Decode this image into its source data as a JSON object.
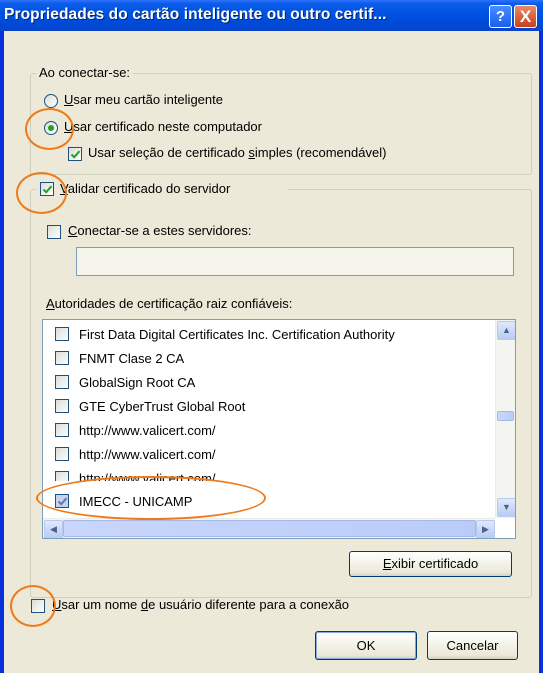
{
  "window": {
    "title": "Propriedades do cartão inteligente ou outro certif...",
    "help_glyph": "?",
    "close_glyph": "X"
  },
  "connect_group": {
    "label": "Ao conectar-se:",
    "radio_smartcard": {
      "prefix": "",
      "underlined": "U",
      "rest": "sar meu cartão inteligente",
      "selected": false
    },
    "radio_certificate": {
      "prefix": "",
      "underlined": "U",
      "rest": "sar certificado neste computador",
      "selected": true
    },
    "simple_selection": {
      "prefix": "Usar seleção de certificado ",
      "underlined": "s",
      "rest": "imples (recomendável)",
      "checked": true
    }
  },
  "validate_group": {
    "validate": {
      "prefix": "",
      "underlined": "V",
      "rest": "alidar certificado do servidor",
      "checked": true
    },
    "connect_servers": {
      "prefix": "",
      "underlined": "C",
      "rest": "onectar-se a estes servidores:",
      "checked": false
    },
    "servers_value": ""
  },
  "root_ca": {
    "label_underlined": "A",
    "label_rest": "utoridades de certificação raiz confiáveis:",
    "items": [
      {
        "label": "First Data Digital Certificates Inc. Certification Authority",
        "checked": false
      },
      {
        "label": "FNMT Clase 2 CA",
        "checked": false
      },
      {
        "label": "GlobalSign Root CA",
        "checked": false
      },
      {
        "label": "GTE CyberTrust Global Root",
        "checked": false
      },
      {
        "label": "http://www.valicert.com/",
        "checked": false
      },
      {
        "label": "http://www.valicert.com/",
        "checked": false
      },
      {
        "label": "http://www.valicert.com/",
        "checked": false
      },
      {
        "label": "IMECC - UNICAMP",
        "checked": true
      }
    ]
  },
  "buttons": {
    "view_cert_underlined": "E",
    "view_cert_rest": "xibir certificado",
    "ok": "OK",
    "cancel": "Cancelar"
  },
  "different_user": {
    "prefix": "",
    "underlined": "U",
    "middle": "sar um nome ",
    "underlined2": "d",
    "rest": "e usuário diferente para a conexão",
    "checked": false
  },
  "colors": {
    "annotation": "#f07a1a",
    "title_bar": "#0054e3",
    "dialog_bg": "#ece9d8"
  },
  "icons": [
    "help-icon",
    "close-icon",
    "chevron-up-icon",
    "chevron-down-icon",
    "chevron-left-icon",
    "chevron-right-icon",
    "checkmark-icon"
  ]
}
